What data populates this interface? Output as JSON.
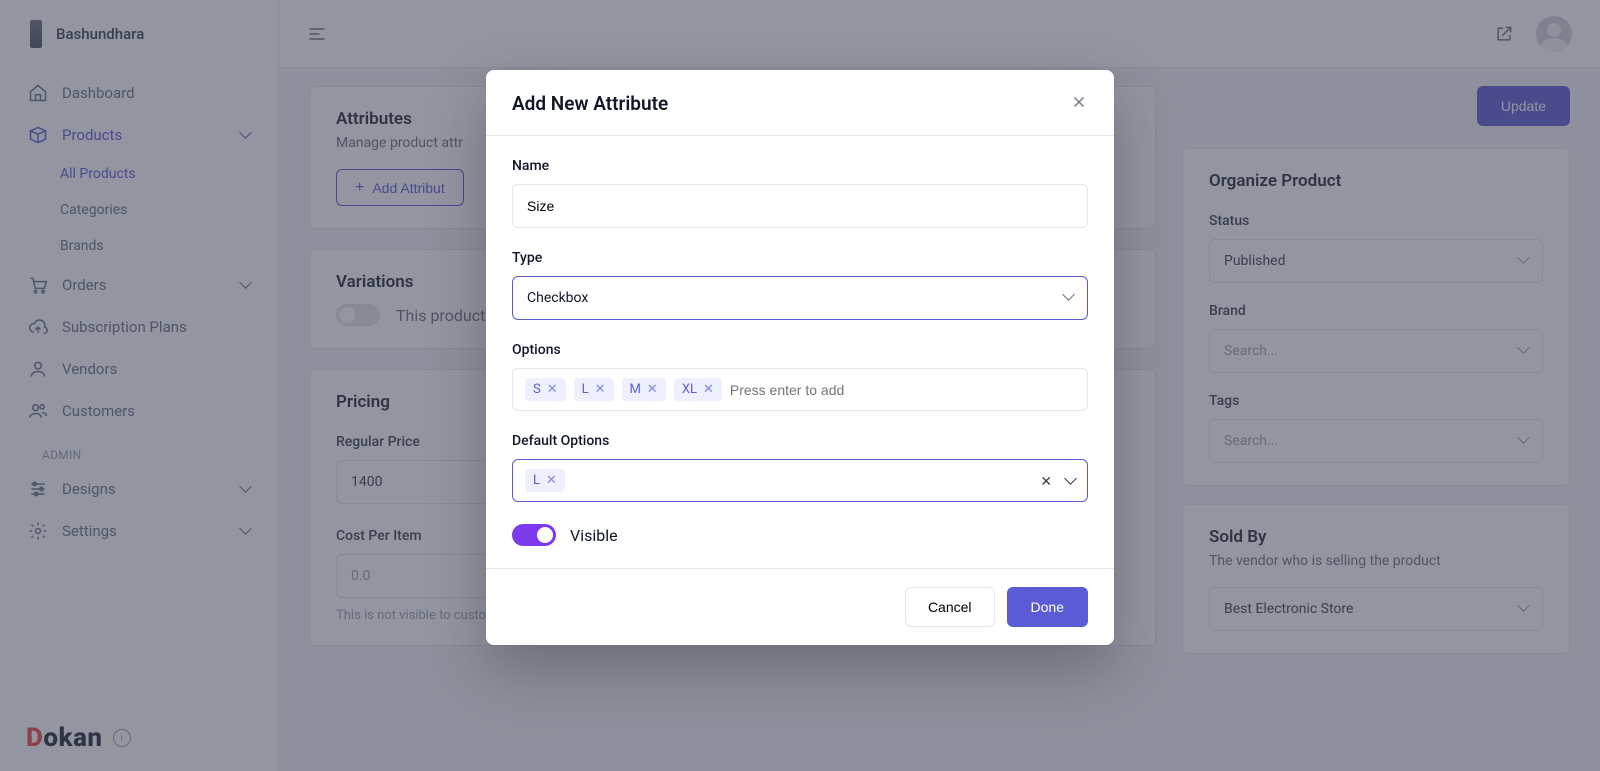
{
  "brand": {
    "name": "Bashundhara"
  },
  "sidebar": {
    "items": [
      {
        "label": "Dashboard"
      },
      {
        "label": "Products"
      },
      {
        "label": "Orders"
      },
      {
        "label": "Subscription Plans"
      },
      {
        "label": "Vendors"
      },
      {
        "label": "Customers"
      },
      {
        "label": "Designs"
      },
      {
        "label": "Settings"
      }
    ],
    "product_sub": [
      {
        "label": "All Products"
      },
      {
        "label": "Categories"
      },
      {
        "label": "Brands"
      }
    ],
    "admin_label": "ADMIN",
    "logo": {
      "d": "D",
      "okan": "okan"
    }
  },
  "topbar": {},
  "main": {
    "update": "Update",
    "attributes": {
      "title": "Attributes",
      "sub": "Manage product attr",
      "button": "Add Attribut"
    },
    "variations": {
      "title": "Variations",
      "text": "This product"
    },
    "pricing": {
      "title": "Pricing",
      "regular_label": "Regular Price",
      "regular_value": "1400",
      "cost_label": "Cost Per Item",
      "cost_value": "0.0",
      "hint": "This is not visible to customer"
    },
    "organize": {
      "title": "Organize Product",
      "status_label": "Status",
      "status_value": "Published",
      "brand_label": "Brand",
      "brand_ph": "Search...",
      "tags_label": "Tags",
      "tags_ph": "Search..."
    },
    "soldby": {
      "title": "Sold By",
      "sub": "The vendor who is selling the product",
      "value": "Best Electronic Store"
    }
  },
  "modal": {
    "title": "Add New Attribute",
    "name_label": "Name",
    "name_value": "Size",
    "type_label": "Type",
    "type_value": "Checkbox",
    "options_label": "Options",
    "options": [
      "S",
      "L",
      "M",
      "XL"
    ],
    "options_ph": "Press enter to add",
    "default_label": "Default Options",
    "default": [
      "L"
    ],
    "visible_label": "Visible",
    "cancel": "Cancel",
    "done": "Done"
  }
}
